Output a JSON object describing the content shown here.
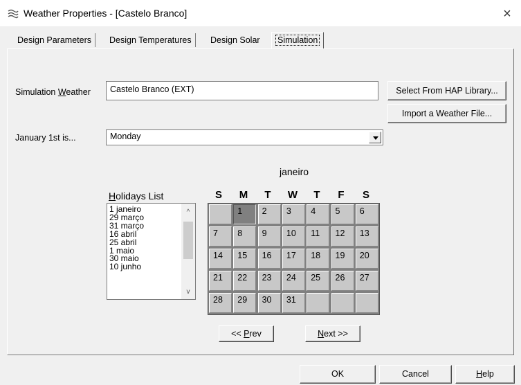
{
  "window": {
    "title": "Weather Properties - [Castelo Branco]",
    "close_glyph": "×",
    "icon": "weather-app-icon"
  },
  "tabs": [
    {
      "label": "Design Parameters",
      "active": false
    },
    {
      "label": "Design Temperatures",
      "active": false
    },
    {
      "label": "Design Solar",
      "active": false
    },
    {
      "label": "Simulation",
      "active": true
    }
  ],
  "simulation": {
    "weather_label_pre": "Simulation ",
    "weather_label_acc": "W",
    "weather_label_post": "eather",
    "weather_value": "Castelo Branco (EXT)",
    "select_library_label": "Select From HAP Library...",
    "import_file_label": "Import a Weather File...",
    "jan1_label": "January 1st is...",
    "jan1_value": "Monday"
  },
  "holidays": {
    "title_acc": "H",
    "title_rest": "olidays List",
    "items": [
      "1 janeiro",
      "29 março",
      "31 março",
      "16 abril",
      "25 abril",
      "1 maio",
      "30 maio",
      "10 junho"
    ],
    "scroll_up": "^",
    "scroll_down": "v"
  },
  "calendar": {
    "month": "janeiro",
    "weekdays": [
      "S",
      "M",
      "T",
      "W",
      "T",
      "F",
      "S"
    ],
    "weeks": [
      [
        "",
        "1",
        "2",
        "3",
        "4",
        "5",
        "6"
      ],
      [
        "7",
        "8",
        "9",
        "10",
        "11",
        "12",
        "13"
      ],
      [
        "14",
        "15",
        "16",
        "17",
        "18",
        "19",
        "20"
      ],
      [
        "21",
        "22",
        "23",
        "24",
        "25",
        "26",
        "27"
      ],
      [
        "28",
        "29",
        "30",
        "31",
        "",
        "",
        ""
      ]
    ],
    "selected_day": "1",
    "prev_pre": "<< ",
    "prev_acc": "P",
    "prev_post": "rev",
    "next_acc": "N",
    "next_post": "ext >>"
  },
  "footer": {
    "ok_label": "OK",
    "cancel_label": "Cancel",
    "help_acc": "H",
    "help_post": "elp"
  }
}
